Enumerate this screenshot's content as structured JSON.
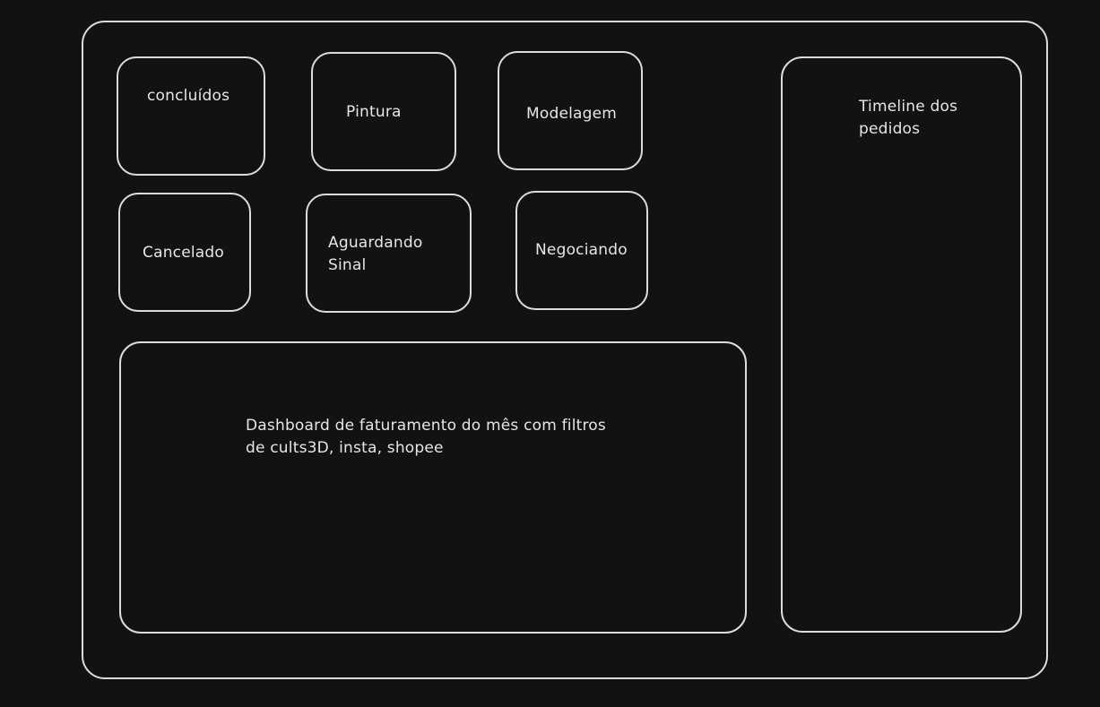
{
  "tiles": {
    "concluidos": {
      "label": "concluídos"
    },
    "pintura": {
      "label": "Pintura"
    },
    "modelagem": {
      "label": "Modelagem"
    },
    "cancelado": {
      "label": "Cancelado"
    },
    "aguardando_sinal": {
      "line1": "Aguardando",
      "line2": "Sinal"
    },
    "negociando": {
      "label": "Negociando"
    }
  },
  "dashboard": {
    "line1": "Dashboard de faturamento do mês com filtros",
    "line2": "de cults3D, insta, shopee"
  },
  "timeline": {
    "line1": "Timeline dos",
    "line2": "pedidos"
  }
}
